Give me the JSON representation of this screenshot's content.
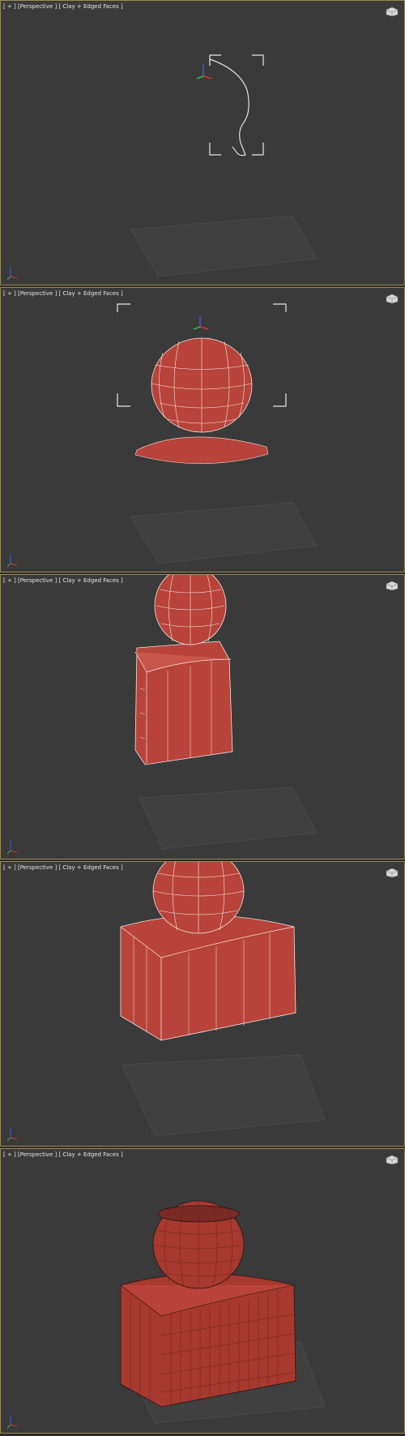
{
  "viewports": [
    {
      "label": "[ + ] [Perspective ] [ Clay + Edged Faces ]",
      "step": "spline profile"
    },
    {
      "label": "[ + ] [Perspective ] [ Clay + Edged Faces ]",
      "step": "lathe sphere with flared base"
    },
    {
      "label": "[ + ] [Perspective ] [ Clay + Edged Faces ]",
      "step": "sphere on narrow box"
    },
    {
      "label": "[ + ] [Perspective ] [ Clay + Edged Faces ]",
      "step": "sphere on wide box"
    },
    {
      "label": "[ + ] [Perspective ] [ Clay + Edged Faces ]",
      "step": "final smoothed mesh"
    }
  ],
  "colors": {
    "viewport_bg": "#3a3a3a",
    "active_border": "#9a8a54",
    "mesh_fill": "#b8433a",
    "mesh_fill_dark": "#8e2f29",
    "wire": "#f2e6e0",
    "grid": "#4e4e4e"
  }
}
